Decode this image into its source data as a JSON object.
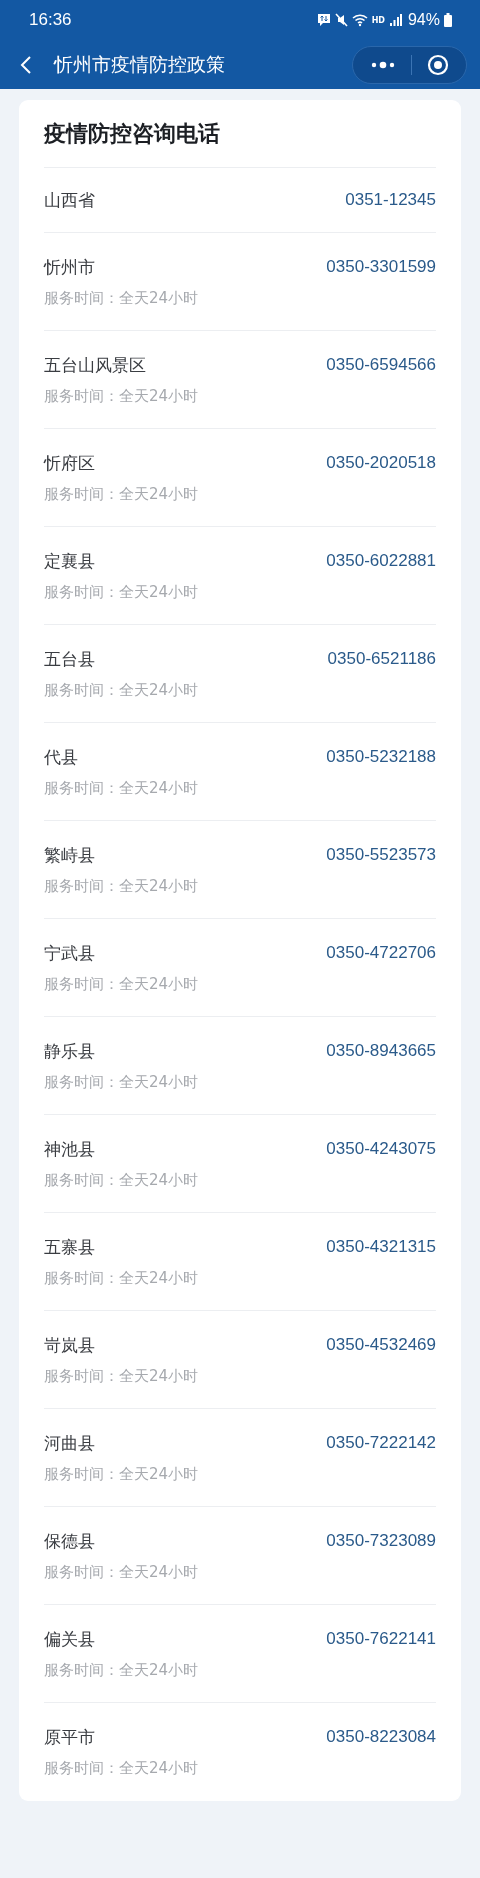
{
  "status_bar": {
    "time": "16:36",
    "network": "HD",
    "battery": "94%"
  },
  "nav_bar": {
    "title": "忻州市疫情防控政策"
  },
  "card": {
    "title": "疫情防控咨询电话",
    "contacts": [
      {
        "name": "山西省",
        "phone": "0351-12345"
      },
      {
        "name": "忻州市",
        "phone": "0350-3301599",
        "hours": "服务时间：全天24小时"
      },
      {
        "name": "五台山风景区",
        "phone": "0350-6594566",
        "hours": "服务时间：全天24小时"
      },
      {
        "name": "忻府区",
        "phone": "0350-2020518",
        "hours": "服务时间：全天24小时"
      },
      {
        "name": "定襄县",
        "phone": "0350-6022881",
        "hours": "服务时间：全天24小时"
      },
      {
        "name": "五台县",
        "phone": "0350-6521186",
        "hours": "服务时间：全天24小时"
      },
      {
        "name": "代县",
        "phone": "0350-5232188",
        "hours": "服务时间：全天24小时"
      },
      {
        "name": "繁峙县",
        "phone": "0350-5523573",
        "hours": "服务时间：全天24小时"
      },
      {
        "name": "宁武县",
        "phone": "0350-4722706",
        "hours": "服务时间：全天24小时"
      },
      {
        "name": "静乐县",
        "phone": "0350-8943665",
        "hours": "服务时间：全天24小时"
      },
      {
        "name": "神池县",
        "phone": "0350-4243075",
        "hours": "服务时间：全天24小时"
      },
      {
        "name": "五寨县",
        "phone": "0350-4321315",
        "hours": "服务时间：全天24小时"
      },
      {
        "name": "岢岚县",
        "phone": "0350-4532469",
        "hours": "服务时间：全天24小时"
      },
      {
        "name": "河曲县",
        "phone": "0350-7222142",
        "hours": "服务时间：全天24小时"
      },
      {
        "name": "保德县",
        "phone": "0350-7323089",
        "hours": "服务时间：全天24小时"
      },
      {
        "name": "偏关县",
        "phone": "0350-7622141",
        "hours": "服务时间：全天24小时"
      },
      {
        "name": "原平市",
        "phone": "0350-8223084",
        "hours": "服务时间：全天24小时"
      }
    ]
  }
}
